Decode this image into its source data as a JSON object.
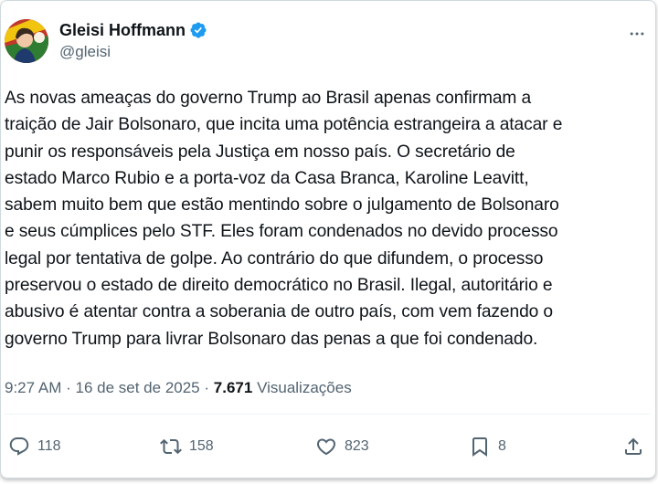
{
  "author": {
    "name": "Gleisi Hoffmann",
    "handle": "@gleisi",
    "verified": true
  },
  "icons": {
    "verified": "verified-badge-icon",
    "more": "more-options-icon",
    "reply": "reply-icon",
    "repost": "repost-icon",
    "like": "like-icon",
    "bookmark": "bookmark-icon",
    "share": "share-icon"
  },
  "colors": {
    "verified": "#1d9bf0",
    "text": "#0f1419",
    "muted": "#536471"
  },
  "tweet": {
    "text": "As novas ameaças do governo Trump ao Brasil apenas confirmam a\ntraição de Jair Bolsonaro, que incita uma potência estrangeira a atacar e\npunir os responsáveis pela Justiça em nosso país. O secretário de\nestado Marco Rubio e a porta-voz da Casa Branca, Karoline Leavitt,\nsabem muito bem que estão mentindo sobre o julgamento de Bolsonaro\ne seus cúmplices pelo STF. Eles foram condenados no devido processo\nlegal por tentativa de golpe. Ao contrário do que difundem, o processo\npreservou o estado de direito democrático no Brasil. Ilegal, autoritário e\nabusivo é atentar contra a soberania de outro país, com vem fazendo o\ngoverno Trump para livrar Bolsonaro das penas a que foi condenado.",
    "time": "9:27 AM",
    "separator": "·",
    "date": "16 de set de 2025",
    "views_count": "7.671",
    "views_label": "Visualizações"
  },
  "stats": {
    "replies": "118",
    "reposts": "158",
    "likes": "823",
    "bookmarks": "8"
  }
}
